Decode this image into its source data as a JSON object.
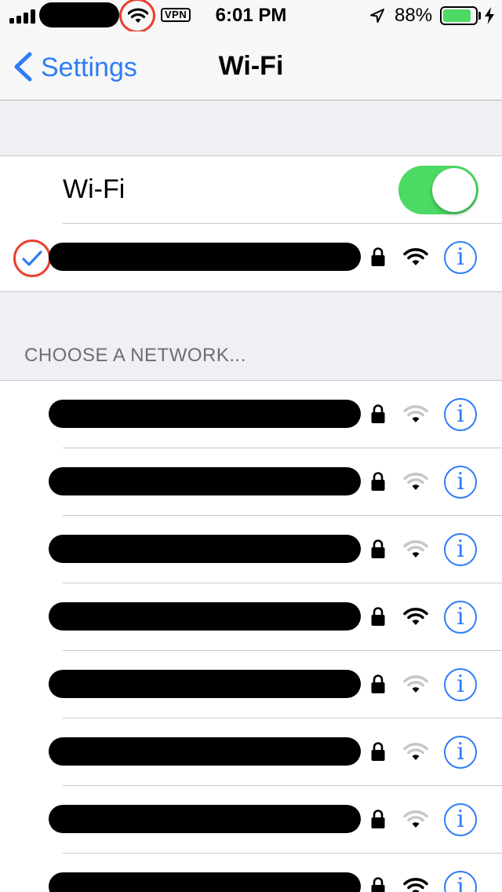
{
  "status_bar": {
    "time": "6:01 PM",
    "vpn_label": "VPN",
    "battery_percent": "88%",
    "battery_level": 0.88,
    "signal_bars": 4,
    "icons": [
      "signal-icon",
      "wifi-icon",
      "location-arrow-icon",
      "battery-icon",
      "charging-bolt-icon"
    ]
  },
  "nav": {
    "back_label": "Settings",
    "title": "Wi-Fi"
  },
  "wifi_toggle": {
    "label": "Wi-Fi",
    "on": true
  },
  "connected_network": {
    "ssid_redacted": true,
    "secured": true,
    "signal_strength": "full"
  },
  "networks_section": {
    "header": "CHOOSE A NETWORK...",
    "networks": [
      {
        "ssid_redacted": true,
        "secured": true,
        "signal_strength": "low"
      },
      {
        "ssid_redacted": true,
        "secured": true,
        "signal_strength": "low"
      },
      {
        "ssid_redacted": true,
        "secured": true,
        "signal_strength": "low"
      },
      {
        "ssid_redacted": true,
        "secured": true,
        "signal_strength": "full"
      },
      {
        "ssid_redacted": true,
        "secured": true,
        "signal_strength": "low"
      },
      {
        "ssid_redacted": true,
        "secured": true,
        "signal_strength": "low"
      },
      {
        "ssid_redacted": true,
        "secured": true,
        "signal_strength": "low"
      },
      {
        "ssid_redacted": true,
        "secured": true,
        "signal_strength": "full"
      }
    ]
  },
  "colors": {
    "accent": "#2f7cf6",
    "toggle_on": "#4cd964",
    "battery": "#4cd964",
    "highlight_circle": "#e8412c",
    "background": "#efeff4",
    "signal_dim": "#c7c7c7"
  }
}
